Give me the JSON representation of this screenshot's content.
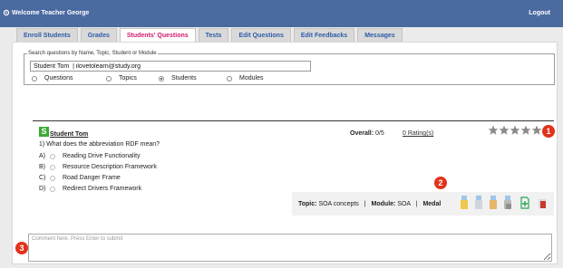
{
  "header": {
    "welcome": "Welcome Teacher George",
    "logout": "Logout"
  },
  "tabs": [
    {
      "label": "Enroll Students",
      "active": false
    },
    {
      "label": "Grades",
      "active": false
    },
    {
      "label": "Students' Questions",
      "active": true
    },
    {
      "label": "Tests",
      "active": false
    },
    {
      "label": "Edit Questions",
      "active": false
    },
    {
      "label": "Edit Feedbacks",
      "active": false
    },
    {
      "label": "Messages",
      "active": false
    }
  ],
  "search": {
    "legend": "Search questions by Name, Topic, Student or Module",
    "value": "Student Tom  | ilovetolearn@study.org",
    "options": [
      {
        "label": "Questions",
        "selected": false
      },
      {
        "label": "Topics",
        "selected": false
      },
      {
        "label": "Students",
        "selected": true
      },
      {
        "label": "Modules",
        "selected": false
      }
    ]
  },
  "question": {
    "badge": "S",
    "student": "Student Tom",
    "text": "1) What does the abbreviation RDF mean?",
    "answers": [
      {
        "letter": "A)",
        "text": "Reading Drive Functionality"
      },
      {
        "letter": "B)",
        "text": "Resource Description Framework"
      },
      {
        "letter": "C)",
        "text": "Road Danger Frame"
      },
      {
        "letter": "D)",
        "text": "Redirect Drivers Framework"
      }
    ],
    "overall_label": "Overall:",
    "overall_value": "0/5",
    "ratings_link": "0 Rating(s)",
    "stars_filled": 0,
    "stars_total": 5
  },
  "meta": {
    "topic_label": "Topic:",
    "topic_value": "SOA concepts",
    "separator": "|",
    "module_label": "Module:",
    "module_value": "SOA",
    "medal_label": "Medal"
  },
  "markers": [
    "1",
    "2",
    "3"
  ],
  "comment": {
    "placeholder": "Comment here. Press Enter to submit"
  },
  "colors": {
    "header_bg": "#4a6aa0",
    "tab_text": "#2e5ca6",
    "tab_active_text": "#d01a6b",
    "badge_green": "#3aaa35",
    "marker_red": "#e2321b",
    "star_gray": "#8a8a8a"
  },
  "icons": [
    "gear-icon",
    "star-icon",
    "medal-gold-icon",
    "medal-silver-icon",
    "medal-bronze-icon",
    "medal-stack-icon",
    "add-file-icon",
    "report-icon"
  ]
}
